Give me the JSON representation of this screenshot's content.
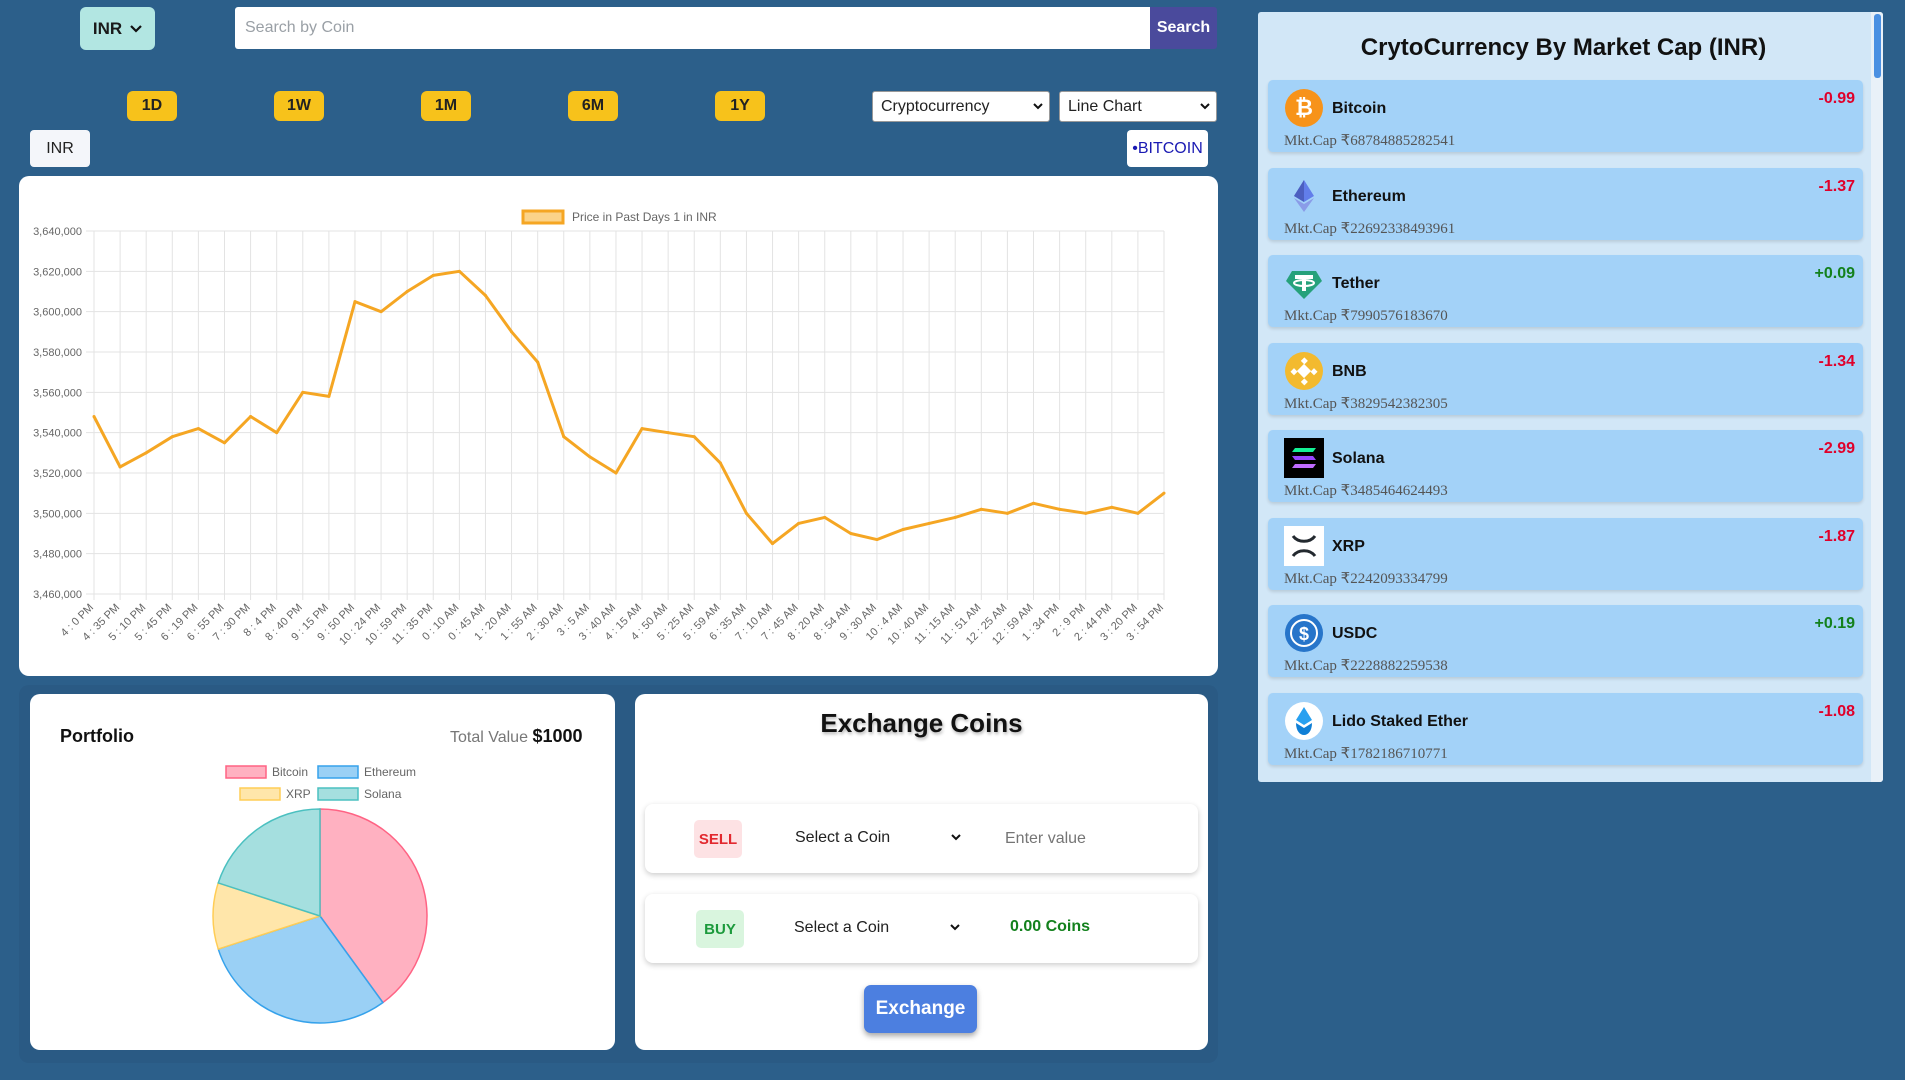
{
  "header": {
    "currency": "INR",
    "search_placeholder": "Search by Coin",
    "search_button": "Search"
  },
  "periods": [
    "1D",
    "1W",
    "1M",
    "6M",
    "1Y"
  ],
  "selectors": {
    "category": "Cryptocurrency",
    "chart_type": "Line Chart"
  },
  "chips": {
    "currency": "INR",
    "coin": "•BITCOIN"
  },
  "colors": {
    "background": "#2c5f8a",
    "accent_yellow": "#f7c21b",
    "line": "#f5a623",
    "card_blue": "#a3d2f8",
    "negative": "#e0002a",
    "positive": "#13811d"
  },
  "chart_data": {
    "type": "line",
    "legend": "Price in Past Days 1 in INR",
    "ylim": [
      3460000,
      3640000
    ],
    "yticks": [
      "3,640,000",
      "3,620,000",
      "3,600,000",
      "3,580,000",
      "3,560,000",
      "3,540,000",
      "3,520,000",
      "3,500,000",
      "3,480,000",
      "3,460,000"
    ],
    "x": [
      "4 : 0 PM",
      "4 : 35 PM",
      "5 : 10 PM",
      "5 : 45 PM",
      "6 : 19 PM",
      "6 : 55 PM",
      "7 : 30 PM",
      "8 : 4 PM",
      "8 : 40 PM",
      "9 : 15 PM",
      "9 : 50 PM",
      "10 : 24 PM",
      "10 : 59 PM",
      "11 : 35 PM",
      "0 : 10 AM",
      "0 : 45 AM",
      "1 : 20 AM",
      "1 : 55 AM",
      "2 : 30 AM",
      "3 : 5 AM",
      "3 : 40 AM",
      "4 : 15 AM",
      "4 : 50 AM",
      "5 : 25 AM",
      "5 : 59 AM",
      "6 : 35 AM",
      "7 : 10 AM",
      "7 : 45 AM",
      "8 : 20 AM",
      "8 : 54 AM",
      "9 : 30 AM",
      "10 : 4 AM",
      "10 : 40 AM",
      "11 : 15 AM",
      "11 : 51 AM",
      "12 : 25 AM",
      "12 : 59 AM",
      "1 : 34 PM",
      "2 : 9 PM",
      "2 : 44 PM",
      "3 : 20 PM",
      "3 : 54 PM"
    ],
    "values": [
      3548000,
      3523000,
      3530000,
      3538000,
      3542000,
      3535000,
      3548000,
      3540000,
      3560000,
      3558000,
      3605000,
      3600000,
      3610000,
      3618000,
      3620000,
      3608000,
      3590000,
      3575000,
      3538000,
      3528000,
      3520000,
      3542000,
      3540000,
      3538000,
      3525000,
      3500000,
      3485000,
      3495000,
      3498000,
      3490000,
      3487000,
      3492000,
      3495000,
      3498000,
      3502000,
      3500000,
      3505000,
      3502000,
      3500000,
      3503000,
      3500000,
      3510000
    ],
    "grid": true
  },
  "portfolio": {
    "title": "Portfolio",
    "total_label": "Total Value",
    "total_value": "$1000",
    "chart_data": {
      "type": "pie",
      "labels": [
        "Bitcoin",
        "Ethereum",
        "XRP",
        "Solana"
      ],
      "values": [
        40,
        30,
        10,
        20
      ],
      "colors": [
        "#ffb1c1",
        "#9ad0f5",
        "#ffe6aa",
        "#a5dfdf"
      ]
    }
  },
  "exchange": {
    "title": "Exchange Coins",
    "sell_tag": "SELL",
    "buy_tag": "BUY",
    "select_label": "Select a Coin",
    "value_placeholder": "Enter value",
    "coins_output": "0.00 Coins",
    "button": "Exchange"
  },
  "market": {
    "title": "CrytoCurrency By Market Cap (INR)",
    "coins": [
      {
        "name": "Bitcoin",
        "cap": "Mkt.Cap ₹68784885282541",
        "change": "-0.99",
        "icon": "bitcoin-icon"
      },
      {
        "name": "Ethereum",
        "cap": "Mkt.Cap ₹22692338493961",
        "change": "-1.37",
        "icon": "ethereum-icon"
      },
      {
        "name": "Tether",
        "cap": "Mkt.Cap ₹7990576183670",
        "change": "+0.09",
        "icon": "tether-icon"
      },
      {
        "name": "BNB",
        "cap": "Mkt.Cap ₹3829542382305",
        "change": "-1.34",
        "icon": "bnb-icon"
      },
      {
        "name": "Solana",
        "cap": "Mkt.Cap ₹3485464624493",
        "change": "-2.99",
        "icon": "solana-icon"
      },
      {
        "name": "XRP",
        "cap": "Mkt.Cap ₹2242093334799",
        "change": "-1.87",
        "icon": "xrp-icon"
      },
      {
        "name": "USDC",
        "cap": "Mkt.Cap ₹2228882259538",
        "change": "+0.19",
        "icon": "usdc-icon"
      },
      {
        "name": "Lido Staked Ether",
        "cap": "Mkt.Cap ₹1782186710771",
        "change": "-1.08",
        "icon": "lido-icon"
      }
    ]
  }
}
